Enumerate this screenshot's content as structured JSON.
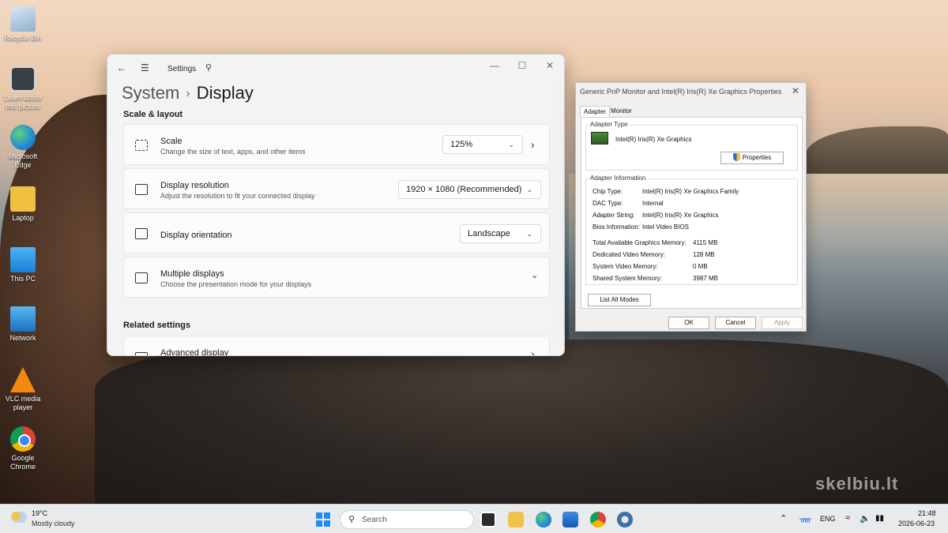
{
  "desktop": {
    "icons": [
      {
        "label": "Recycle Bin",
        "icon": "recycle-bin-icon"
      },
      {
        "label": "Learn about this picture",
        "icon": "learn-picture-icon"
      },
      {
        "label": "Microsoft Edge",
        "icon": "edge-icon"
      },
      {
        "label": "Laptop",
        "icon": "folder-user-icon"
      },
      {
        "label": "This PC",
        "icon": "monitor-icon"
      },
      {
        "label": "Network",
        "icon": "network-icon"
      },
      {
        "label": "VLC media player",
        "icon": "vlc-icon"
      },
      {
        "label": "Google Chrome",
        "icon": "chrome-icon"
      }
    ],
    "watermark": "skelbiu.lt"
  },
  "settings": {
    "title": "Settings",
    "breadcrumb_parent": "System",
    "breadcrumb_current": "Display",
    "section_scale": "Scale & layout",
    "scale": {
      "title": "Scale",
      "subtitle": "Change the size of text, apps, and other items",
      "value": "125%"
    },
    "resolution": {
      "title": "Display resolution",
      "subtitle": "Adjust the resolution to fit your connected display",
      "value": "1920 × 1080 (Recommended)"
    },
    "orientation": {
      "title": "Display orientation",
      "value": "Landscape"
    },
    "multiple": {
      "title": "Multiple displays",
      "subtitle": "Choose the presentation mode for your displays"
    },
    "section_related": "Related settings",
    "advanced": {
      "title": "Advanced display"
    }
  },
  "props": {
    "title": "Generic PnP Monitor and Intel(R) Iris(R) Xe Graphics Properties",
    "tabs": [
      "Adapter",
      "Monitor"
    ],
    "adapter_type_label": "Adapter Type",
    "adapter_name": "Intel(R) Iris(R) Xe Graphics",
    "properties_button": "Properties",
    "adapter_info_label": "Adapter Information",
    "info": [
      {
        "key": "Chip Type:",
        "value": "Intel(R) Iris(R) Xe Graphics Family"
      },
      {
        "key": "DAC Type:",
        "value": "Internal"
      },
      {
        "key": "Adapter String:",
        "value": "Intel(R) Iris(R) Xe Graphics"
      },
      {
        "key": "Bios Information:",
        "value": "Intel Video BIOS"
      }
    ],
    "memory": [
      {
        "key": "Total Available Graphics Memory:",
        "value": "4115 MB"
      },
      {
        "key": "Dedicated Video Memory:",
        "value": "128 MB"
      },
      {
        "key": "System Video Memory:",
        "value": "0 MB"
      },
      {
        "key": "Shared System Memory:",
        "value": "3987 MB"
      }
    ],
    "list_modes_button": "List All Modes",
    "ok": "OK",
    "cancel": "Cancel",
    "apply": "Apply"
  },
  "taskbar": {
    "temperature": "19°C",
    "condition": "Mostly cloudy",
    "search_placeholder": "Search",
    "language": "ENG",
    "time": "21:48",
    "date": "2026-06-23"
  }
}
